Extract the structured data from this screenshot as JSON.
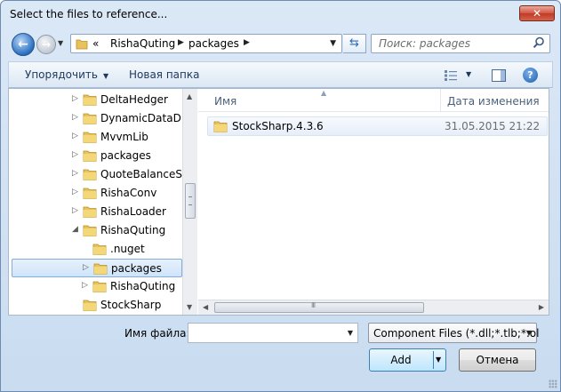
{
  "window": {
    "title": "Select the files to reference...",
    "close_label": "✕"
  },
  "navigation": {
    "breadcrumbs": [
      "«",
      "RishaQuting",
      "packages"
    ],
    "search_placeholder": "Поиск: packages"
  },
  "toolbar": {
    "organize_label": "Упорядочить",
    "new_folder_label": "Новая папка",
    "help_label": "?"
  },
  "tree": {
    "items": [
      {
        "label": "DeltaHedger",
        "expander": "▷"
      },
      {
        "label": "DynamicDataDisp",
        "expander": "▷"
      },
      {
        "label": "MvvmLib",
        "expander": "▷"
      },
      {
        "label": "packages",
        "expander": "▷"
      },
      {
        "label": "QuoteBalanceSav",
        "expander": "▷"
      },
      {
        "label": "RishaConv",
        "expander": "▷"
      },
      {
        "label": "RishaLoader",
        "expander": "▷"
      },
      {
        "label": "RishaQuting",
        "expander": "◢"
      },
      {
        "label": ".nuget",
        "expander": ""
      },
      {
        "label": "packages",
        "expander": "▷"
      },
      {
        "label": "RishaQuting",
        "expander": "▷"
      },
      {
        "label": "StockSharp",
        "expander": ""
      }
    ]
  },
  "files": {
    "columns": {
      "name": "Имя",
      "date": "Дата изменения"
    },
    "rows": [
      {
        "name": "StockSharp.4.3.6",
        "date": "31.05.2015 21:22"
      }
    ]
  },
  "footer": {
    "filename_label": "Имя файла:",
    "filename_value": "",
    "filter_value": "Component Files (*.dll;*.tlb;*.ol",
    "add_label": "Add",
    "cancel_label": "Отмена"
  }
}
